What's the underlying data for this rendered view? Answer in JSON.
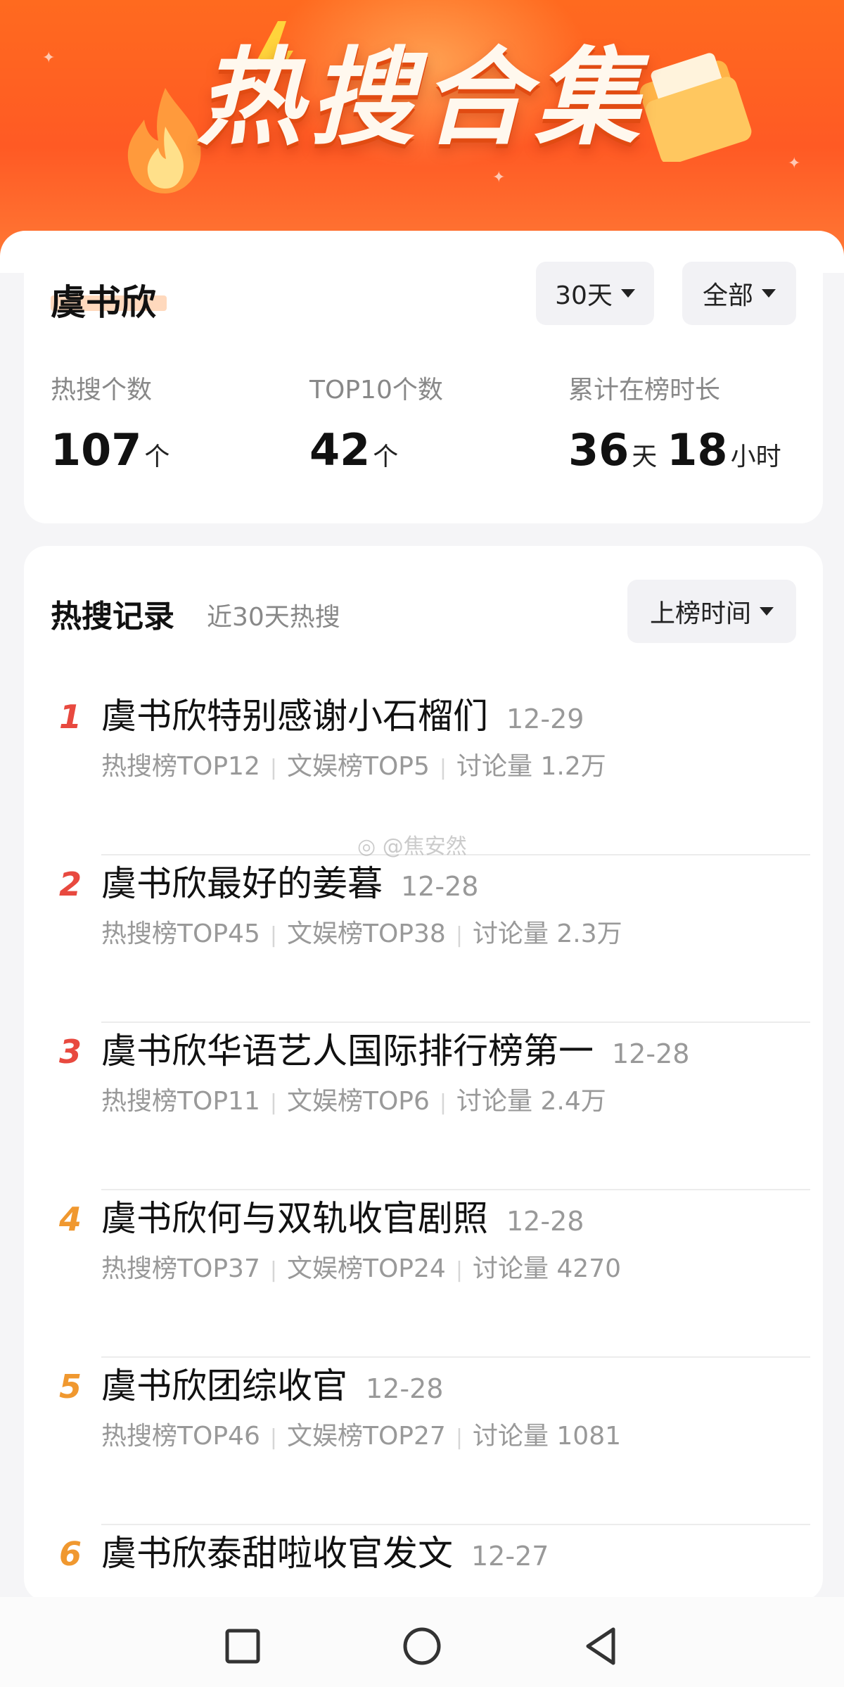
{
  "banner": {
    "title": "热搜合集"
  },
  "profile": {
    "name": "虞书欣"
  },
  "filters": {
    "period": "30天",
    "scope": "全部"
  },
  "stats": [
    {
      "label": "热搜个数",
      "value": "107",
      "unit": "个"
    },
    {
      "label": "TOP10个数",
      "value": "42",
      "unit": "个"
    },
    {
      "label": "累计在榜时长",
      "days": "36",
      "days_unit": "天",
      "hours": "18",
      "hours_unit": "小时"
    }
  ],
  "records": {
    "title": "热搜记录",
    "subtitle": "近30天热搜",
    "sort_label": "上榜时间",
    "items": [
      {
        "rank": "1",
        "title": "虞书欣特别感谢小石榴们",
        "date": "12-29",
        "hot": "热搜榜TOP12",
        "ent": "文娱榜TOP5",
        "discuss": "讨论量 1.2万"
      },
      {
        "rank": "2",
        "title": "虞书欣最好的姜暮",
        "date": "12-28",
        "hot": "热搜榜TOP45",
        "ent": "文娱榜TOP38",
        "discuss": "讨论量 2.3万"
      },
      {
        "rank": "3",
        "title": "虞书欣华语艺人国际排行榜第一",
        "date": "12-28",
        "hot": "热搜榜TOP11",
        "ent": "文娱榜TOP6",
        "discuss": "讨论量 2.4万"
      },
      {
        "rank": "4",
        "title": "虞书欣何与双轨收官剧照",
        "date": "12-28",
        "hot": "热搜榜TOP37",
        "ent": "文娱榜TOP24",
        "discuss": "讨论量 4270"
      },
      {
        "rank": "5",
        "title": "虞书欣团综收官",
        "date": "12-28",
        "hot": "热搜榜TOP46",
        "ent": "文娱榜TOP27",
        "discuss": "讨论量 1081"
      },
      {
        "rank": "6",
        "title": "虞书欣泰甜啦收官发文",
        "date": "12-27",
        "hot": "",
        "ent": "",
        "discuss": ""
      }
    ]
  },
  "watermark": "@焦安然",
  "colors": {
    "rank_top3": "#e8493f",
    "rank_other": "#f0982f",
    "accent": "#ff6a1f"
  },
  "navbar": {
    "icons": [
      "square-icon",
      "circle-icon",
      "triangle-back-icon"
    ]
  }
}
